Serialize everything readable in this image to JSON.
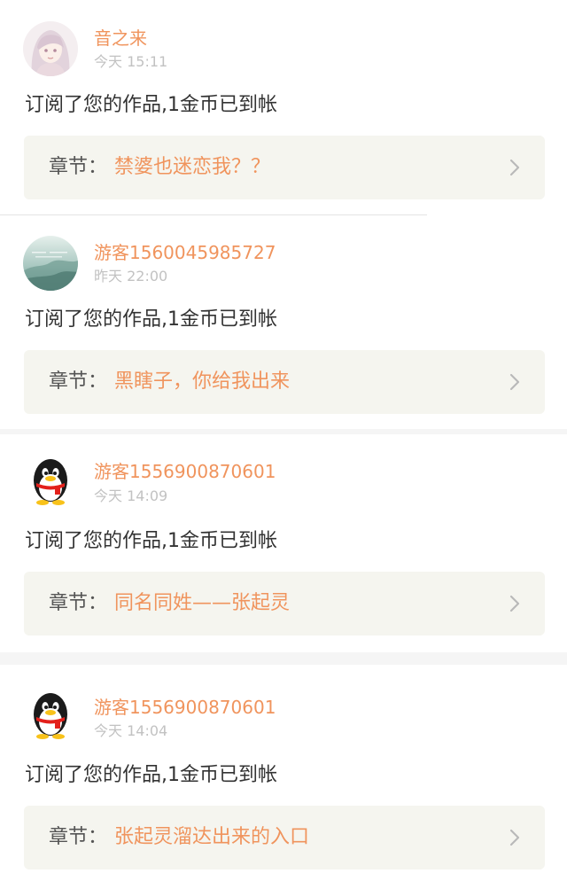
{
  "colors": {
    "accent": "#f0945d",
    "chapter_bg": "#f5f5ef",
    "meta_gray": "#c2c2c2",
    "text_dark": "#333333",
    "chevron_gray": "#b9b9b9",
    "separator": "#f5f5f5"
  },
  "notifications": [
    {
      "avatar_icon": "anime-girl-avatar-icon",
      "username": "音之来",
      "time": "今天 15:11",
      "message": "订阅了您的作品,1金币已到帐",
      "chapter_prefix": "章节：",
      "chapter_title": "禁婆也迷恋我？？"
    },
    {
      "avatar_icon": "misty-landscape-avatar-icon",
      "username": "游客1560045985727",
      "time": "昨天 22:00",
      "message": "订阅了您的作品,1金币已到帐",
      "chapter_prefix": "章节：",
      "chapter_title": "黑瞎子，你给我出来"
    },
    {
      "avatar_icon": "qq-penguin-avatar-icon",
      "username": "游客1556900870601",
      "time": "今天 14:09",
      "message": "订阅了您的作品,1金币已到帐",
      "chapter_prefix": "章节：",
      "chapter_title": "同名同姓——张起灵"
    },
    {
      "avatar_icon": "qq-penguin-avatar-icon",
      "username": "游客1556900870601",
      "time": "今天 14:04",
      "message": "订阅了您的作品,1金币已到帐",
      "chapter_prefix": "章节：",
      "chapter_title": "张起灵溜达出来的入口"
    }
  ]
}
